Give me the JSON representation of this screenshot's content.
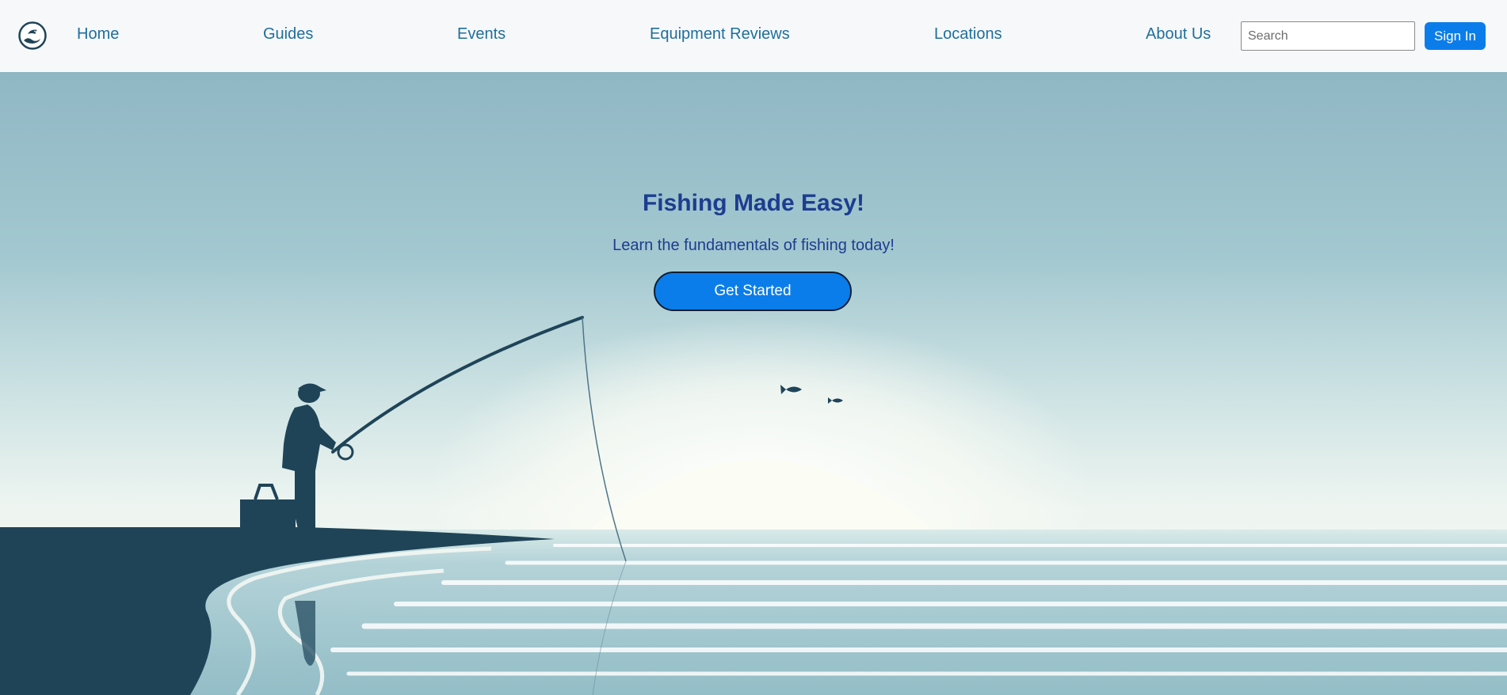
{
  "header": {
    "logo_icon": "fish-wave-logo-icon",
    "nav": [
      {
        "label": "Home"
      },
      {
        "label": "Guides"
      },
      {
        "label": "Events"
      },
      {
        "label": "Equipment Reviews"
      },
      {
        "label": "Locations"
      },
      {
        "label": "About Us"
      }
    ],
    "search": {
      "placeholder": "Search",
      "value": ""
    },
    "signin_label": "Sign In"
  },
  "hero": {
    "title": "Fishing Made Easy!",
    "subtitle": "Learn the fundamentals of fishing today!",
    "cta_label": "Get Started",
    "image": "angler-silhouette-at-lake-sunrise"
  },
  "colors": {
    "nav_link": "#1e6f9c",
    "accent": "#0b7dea",
    "hero_text": "#1c3d8f",
    "sky_top": "#8fb6c2",
    "water": "#9cc4cc",
    "silhouette": "#1f4458"
  }
}
